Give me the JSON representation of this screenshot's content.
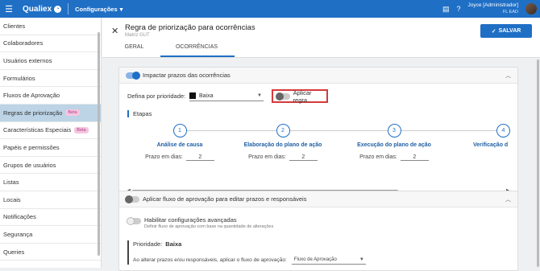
{
  "topbar": {
    "logo": "Qualiex",
    "menu": "Configurações",
    "user_name": "Joyce [Administrador]",
    "user_sub": "FL EAD"
  },
  "sidebar": {
    "items": [
      {
        "label": "Clientes"
      },
      {
        "label": "Colaboradores"
      },
      {
        "label": "Usuários externos"
      },
      {
        "label": "Formulários"
      },
      {
        "label": "Fluxos de Aprovação"
      },
      {
        "label": "Regras de priorização",
        "badge": "Beta"
      },
      {
        "label": "Características Especiais",
        "badge": "Beta"
      },
      {
        "label": "Papéis e permissões"
      },
      {
        "label": "Grupos de usuários"
      },
      {
        "label": "Listas"
      },
      {
        "label": "Locais"
      },
      {
        "label": "Notificações"
      },
      {
        "label": "Segurança"
      },
      {
        "label": "Queries"
      }
    ]
  },
  "header": {
    "title": "Regra de priorização para ocorrências",
    "subtitle": "Matriz GUT",
    "save_label": "SALVAR",
    "tabs": [
      {
        "label": "GERAL"
      },
      {
        "label": "OCORRÊNCIAS"
      }
    ]
  },
  "card1": {
    "title": "Impactar prazos das ocorrências",
    "priority_label": "Defina por prioridade:",
    "priority_value": "Baixa",
    "apply_label": "Aplicar regra",
    "etapas_label": "Etapas",
    "steps": [
      {
        "num": "1",
        "title": "Análise de causa",
        "prazo_label": "Prazo em dias:",
        "prazo": "2"
      },
      {
        "num": "2",
        "title": "Elaboração do plano de ação",
        "prazo_label": "Prazo em dias:",
        "prazo": "2"
      },
      {
        "num": "3",
        "title": "Execução do plano de ação",
        "prazo_label": "Prazo em dias:",
        "prazo": "2"
      },
      {
        "num": "4",
        "title": "Verificação d",
        "prazo_label": "",
        "prazo": ""
      }
    ]
  },
  "card2": {
    "title": "Aplicar fluxo de aprovação para editar prazos e responsáveis",
    "adv_title": "Habilitar configurações avançadas",
    "adv_desc": "Definir fluxo de aprovação com base na quantidade de alterações",
    "prio_label": "Prioridade:",
    "prio_value": "Baixa",
    "alter_label": "Ao alterar prazos e/ou responsáveis, aplicar o fluxo de aprovação:",
    "flux_value": "Fluxo de Aprovação"
  }
}
